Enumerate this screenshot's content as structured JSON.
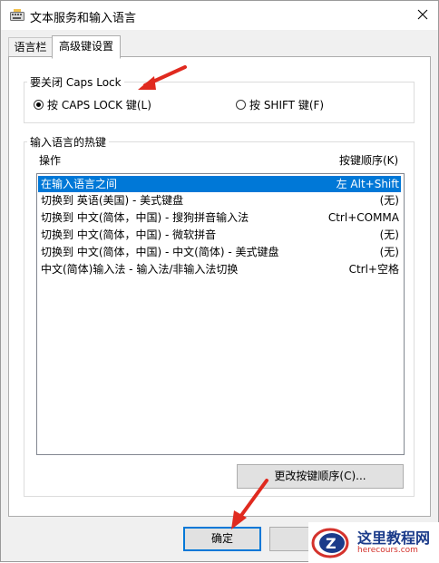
{
  "window": {
    "title": "文本服务和输入语言"
  },
  "tabs": [
    {
      "label": "语言栏",
      "active": false
    },
    {
      "label": "高级键设置",
      "active": true
    }
  ],
  "caps_lock_group": {
    "legend": "要关闭 Caps Lock",
    "options": [
      {
        "label": "按 CAPS LOCK 键(L)",
        "checked": true
      },
      {
        "label": "按 SHIFT 键(F)",
        "checked": false
      }
    ]
  },
  "hotkeys_group": {
    "legend": "输入语言的热键",
    "columns": {
      "action": "操作",
      "keys": "按键顺序(K)"
    },
    "rows": [
      {
        "action": "在输入语言之间",
        "keys": "左 Alt+Shift",
        "selected": true
      },
      {
        "action": "切换到 英语(美国) - 美式键盘",
        "keys": "(无)",
        "selected": false
      },
      {
        "action": "切换到 中文(简体，中国) - 搜狗拼音输入法",
        "keys": "Ctrl+COMMA",
        "selected": false
      },
      {
        "action": "切换到 中文(简体，中国) - 微软拼音",
        "keys": "(无)",
        "selected": false
      },
      {
        "action": "切换到 中文(简体，中国) - 中文(简体) - 美式键盘",
        "keys": "(无)",
        "selected": false
      },
      {
        "action": "中文(简体)输入法 - 输入法/非输入法切换",
        "keys": "Ctrl+空格",
        "selected": false
      }
    ],
    "change_button": "更改按键顺序(C)..."
  },
  "footer": {
    "ok_label": "确定"
  },
  "watermark": {
    "logo_letter": "Z",
    "main": "这里教程网",
    "sub": "herecours.com"
  },
  "colors": {
    "accent": "#0078d7",
    "arrow": "#e02a1f",
    "watermark_blue": "#1b3b8a",
    "watermark_red": "#d4322c"
  },
  "icons": {
    "app": "keyboard-icon",
    "close": "close-icon",
    "annotation": "red-arrow"
  }
}
